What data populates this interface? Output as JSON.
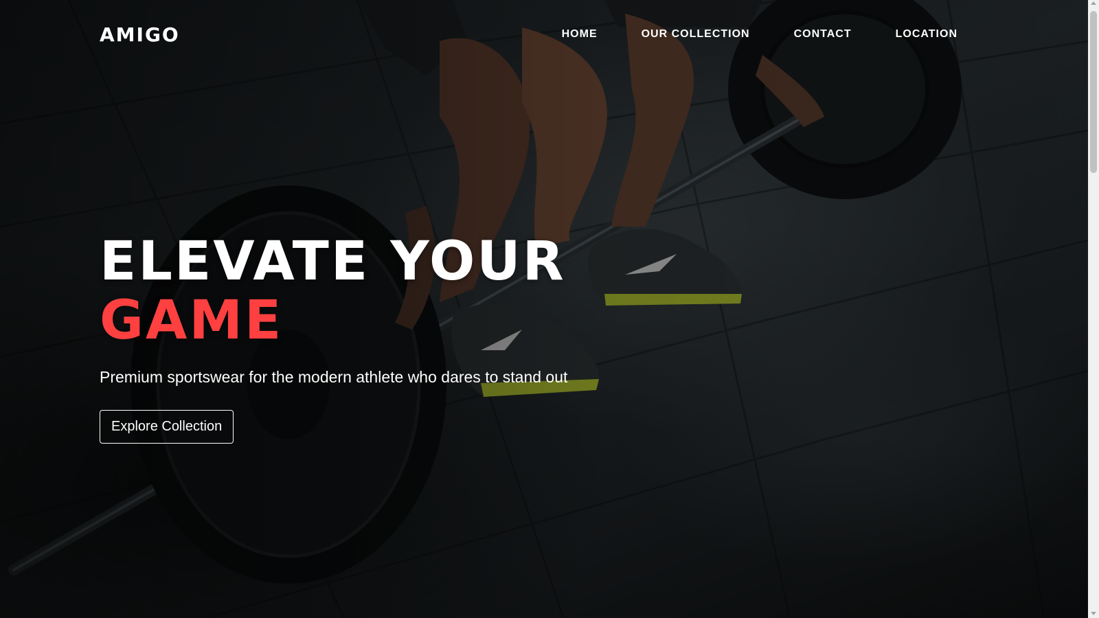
{
  "brand": {
    "logo": "AMIGO"
  },
  "nav": {
    "items": [
      {
        "label": "HOME"
      },
      {
        "label": "OUR COLLECTION"
      },
      {
        "label": "CONTACT"
      },
      {
        "label": "LOCATION"
      }
    ]
  },
  "hero": {
    "headline_line1": "ELEVATE YOUR",
    "headline_line2": "GAME",
    "subtitle": "Premium sportswear for the modern athlete who dares to stand out",
    "cta_label": "Explore Collection"
  },
  "colors": {
    "accent": "#ff4040",
    "text": "#ffffff",
    "background": "#1d2225"
  }
}
